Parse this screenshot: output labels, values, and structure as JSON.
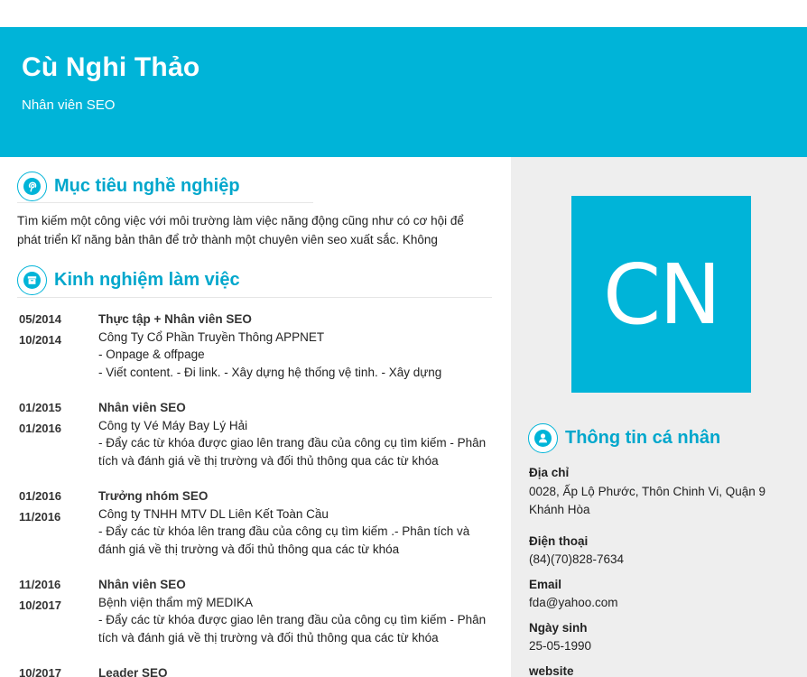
{
  "header": {
    "name": "Cù Nghi Thảo",
    "role": "Nhân viên SEO"
  },
  "objective": {
    "title": "Mục tiêu nghề nghiệp",
    "icon": "pinterest-icon",
    "text": "Tìm kiếm một công việc với môi trường làm việc năng động cũng như có cơ hội để phát triển kĩ năng bản thân để trở thành một chuyên viên seo xuất sắc. Không"
  },
  "experience": {
    "title": "Kinh nghiệm làm việc",
    "icon": "archive-box-icon",
    "jobs": [
      {
        "start": "05/2014",
        "end": "10/2014",
        "title": "Thực tập + Nhân viên SEO",
        "company": "Công Ty Cổ Phần Truyền Thông APPNET",
        "desc": "- Onpage & offpage\n- Viết content.  - Đi link. - Xây dựng hệ thống vệ tinh. - Xây dựng"
      },
      {
        "start": "01/2015",
        "end": "01/2016",
        "title": "Nhân viên SEO",
        "company": "Công ty Vé Máy Bay Lý Hải",
        "desc": "- Đẩy các từ khóa được giao lên trang đầu của công cụ tìm kiếm - Phân tích và đánh giá về thị trường và đối thủ thông qua các từ khóa"
      },
      {
        "start": "01/2016",
        "end": "11/2016",
        "title": "Trưởng nhóm SEO",
        "company": "Công ty TNHH MTV DL Liên Kết Toàn Cầu",
        "desc": "- Đẩy các từ khóa lên trang đầu của công cụ tìm kiếm .- Phân tích và đánh giá về thị trường và đối thủ thông qua các từ khóa"
      },
      {
        "start": "11/2016",
        "end": "10/2017",
        "title": "Nhân viên SEO",
        "company": "Bệnh viện thẩm mỹ MEDIKA",
        "desc": "- Đẩy các từ khóa được giao lên trang đầu của công cụ tìm kiếm - Phân tích và đánh giá về thị trường và đối thủ thông qua các từ khóa"
      },
      {
        "start": "10/2017",
        "end": "",
        "title": "Leader SEO",
        "company": "",
        "desc": ""
      }
    ]
  },
  "avatar": {
    "initials": "CN",
    "color": "#00b4d8"
  },
  "personal": {
    "title": "Thông tin cá nhân",
    "icon": "user-icon",
    "address_label": "Địa chỉ",
    "address": "0028, Ấp Lộ Phước, Thôn Chinh Vi, Quận 9 Khánh Hòa",
    "phone_label": "Điện thoại",
    "phone": "(84)(70)828-7634",
    "email_label": "Email",
    "email": "fda@yahoo.com",
    "dob_label": "Ngày sinh",
    "dob": "25-05-1990",
    "website_label": "website"
  },
  "colors": {
    "accent": "#00b4d8",
    "sidebar": "#eeeeee"
  }
}
